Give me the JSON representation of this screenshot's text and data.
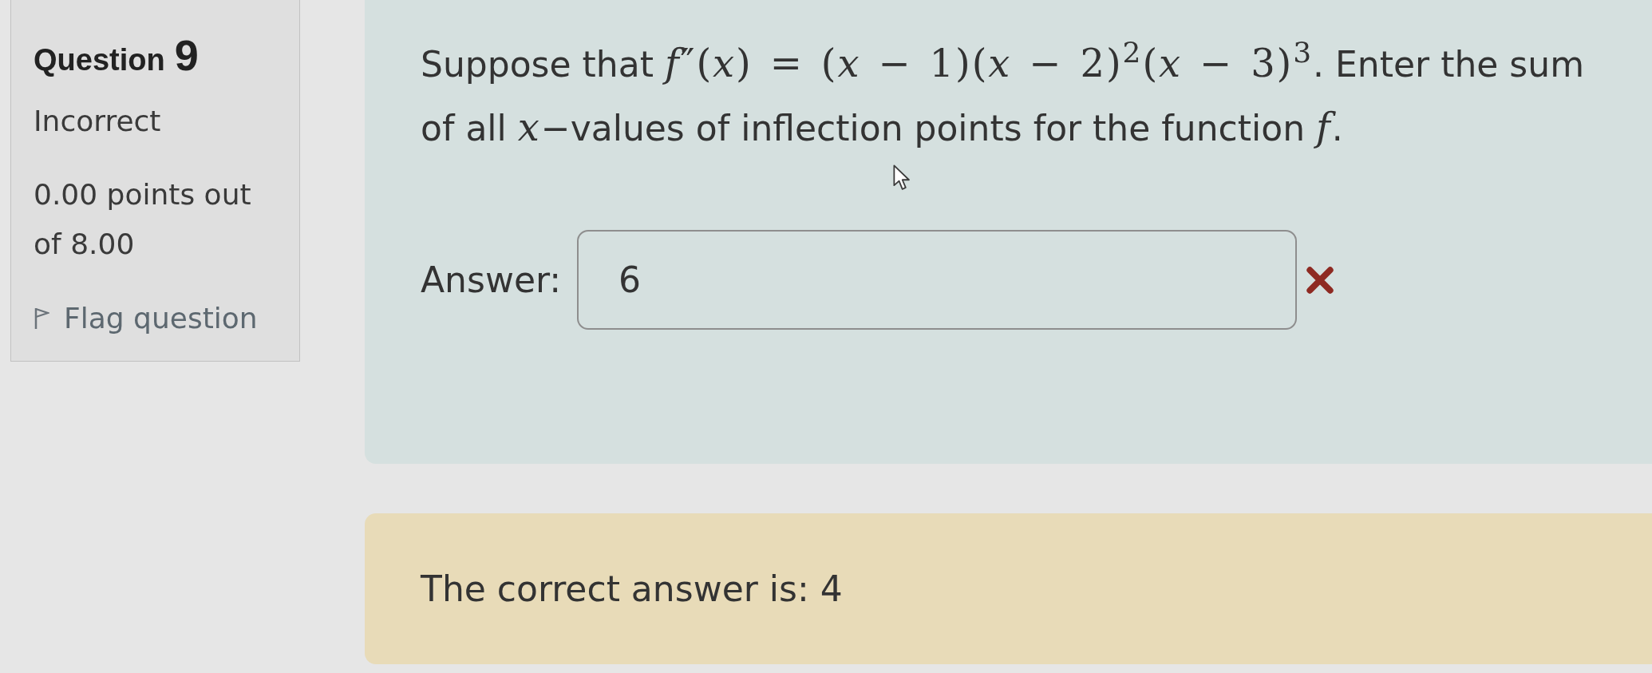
{
  "info": {
    "heading_label": "Question",
    "number": "9",
    "state": "Incorrect",
    "grade": "0.00 points out of 8.00",
    "flag": {
      "label": "Flag question",
      "flagged": false
    }
  },
  "question": {
    "text": [
      {
        "kind": "text",
        "text": "Suppose that "
      },
      {
        "kind": "math",
        "text": "*f*″(*x*) = (*x* − 1)(*x* − 2)$^{2}$(*x* − 3)$^{3}$"
      },
      {
        "kind": "text",
        "text": ". Enter the sum of all "
      },
      {
        "kind": "math",
        "text": "*x*"
      },
      {
        "kind": "text",
        "text": "−values of inflection points for the function "
      },
      {
        "kind": "math",
        "text": "*f*"
      },
      {
        "kind": "text",
        "text": "."
      }
    ],
    "answer": {
      "label": "Answer:",
      "value": "6",
      "correct": false
    }
  },
  "feedback": {
    "text": "The correct answer is: 4"
  }
}
